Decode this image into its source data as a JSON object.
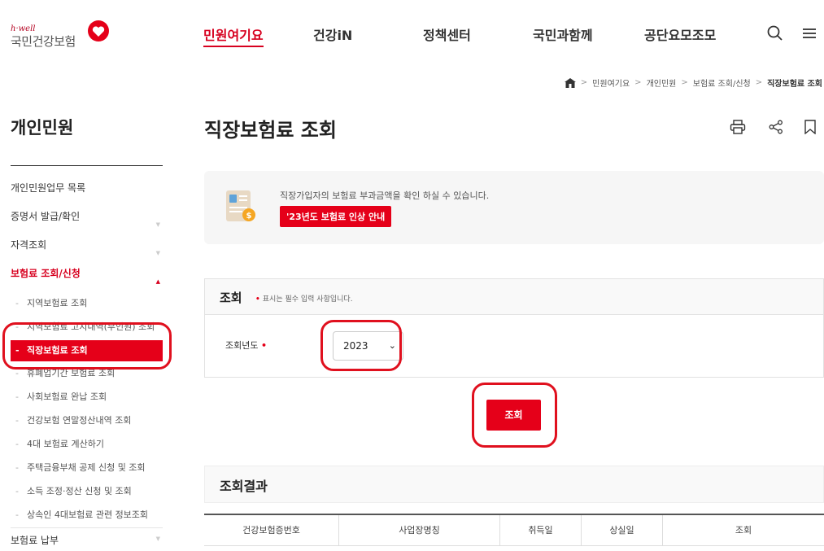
{
  "header": {
    "logo_small": "h·well",
    "logo_main": "국민건강보험",
    "nav": [
      "민원여기요",
      "건강iN",
      "정책센터",
      "국민과함께",
      "공단요모조모"
    ],
    "active_nav": "민원여기요"
  },
  "breadcrumb": {
    "items": [
      "민원여기요",
      "개인민원",
      "보험료 조회/신청"
    ],
    "current": "직장보험료 조회"
  },
  "sidebar": {
    "title": "개인민원",
    "items": [
      {
        "label": "개인민원업무 목록"
      },
      {
        "label": "증명서 발급/확인"
      },
      {
        "label": "자격조회"
      },
      {
        "label": "보험료 조회/신청"
      }
    ],
    "subitems": [
      "지역보험료 조회",
      "지역보험료 고지내역(부인원) 조회",
      "직장보험료 조회",
      "휴폐업기간 보험료 조회",
      "사회보험료 완납 조회",
      "건강보험 연말정산내역 조회",
      "4대 보험료 계산하기",
      "주택금융부채 공제 신청 및 조회",
      "소득 조정·정산 신청 및 조회",
      "상속인 4대보험료 관련 정보조회"
    ],
    "bottom_item": "보험료 납부"
  },
  "main": {
    "title": "직장보험료 조회",
    "info_text": "직장가입자의 보험료 부과금액을 확인 하실 수 있습니다.",
    "info_button": "'23년도 보험료 인상 안내",
    "form_title": "조회",
    "form_note": "표시는 필수 입력 사항입니다.",
    "year_label": "조회년도",
    "year_value": "2023",
    "search_button": "조회",
    "result_title": "조회결과",
    "table_headers": [
      "건강보험증번호",
      "사업장명칭",
      "취득일",
      "상실일",
      "조회"
    ]
  },
  "colors": {
    "accent": "#e50019",
    "annotation": "#e0101e"
  },
  "icons": [
    "search-icon",
    "menu-icon",
    "home-icon",
    "print-icon",
    "share-icon",
    "bookmark-icon",
    "heart-logo-icon",
    "document-coin-illustration"
  ]
}
